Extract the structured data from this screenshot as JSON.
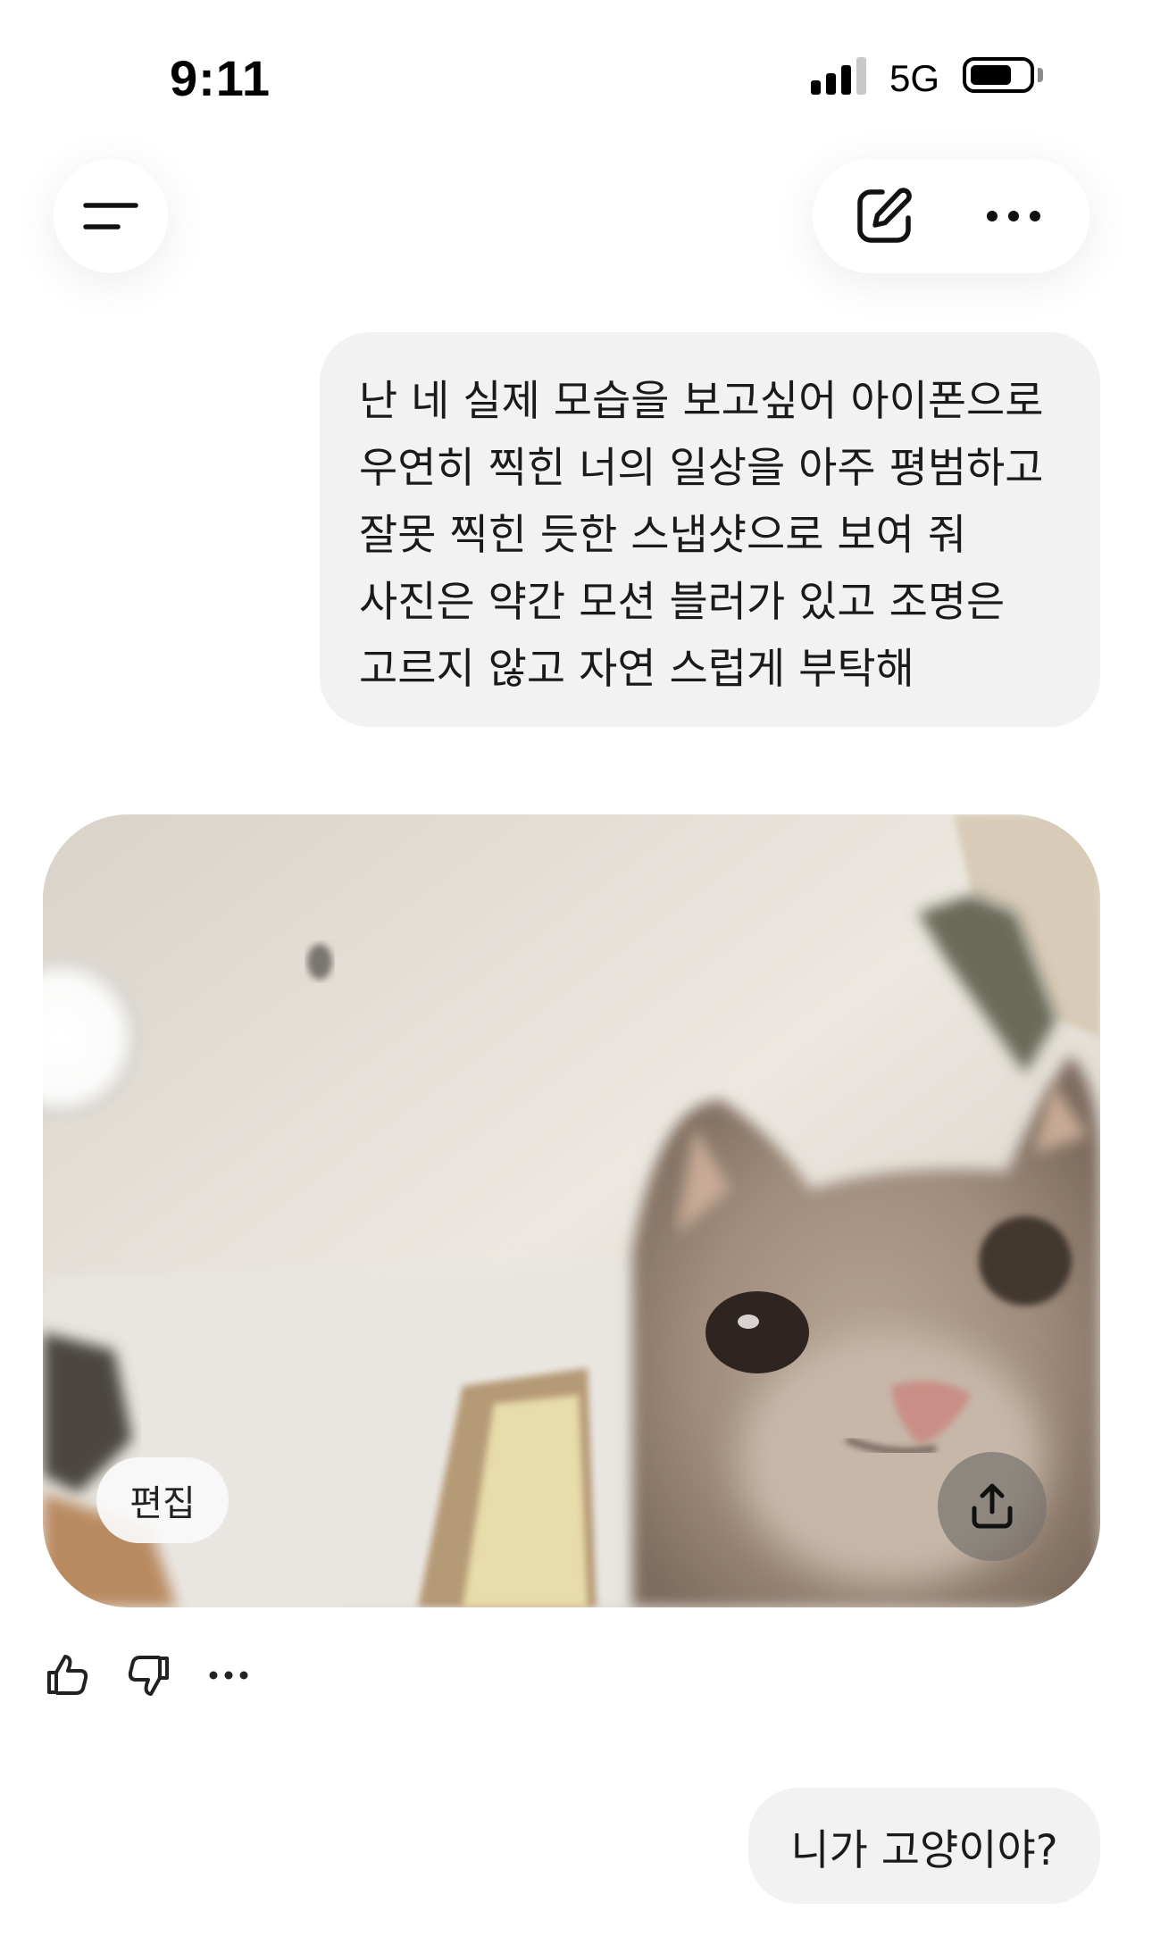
{
  "status_bar": {
    "time": "9:11",
    "network": "5G",
    "signal_bars_filled": 3,
    "signal_bars_total": 4,
    "battery_level": 0.72
  },
  "header": {
    "menu_icon": "menu-icon",
    "new_chat_icon": "compose-icon",
    "more_icon": "more-horizontal-icon"
  },
  "messages": [
    {
      "role": "user",
      "lines": [
        "난 네 실제 모습을 보고싶어 아이폰으로",
        "우연히 찍힌 너의 일상을 아주 평범하고",
        "잘못 찍힌 듯한 스냅샷으로 보여 줘",
        "사진은 약간 모션 블러가 있고 조명은",
        "고르지 않고 자연 스럽게 부탁해"
      ]
    },
    {
      "role": "assistant",
      "image": {
        "edit_label": "편집",
        "share_icon": "share-upload-icon"
      },
      "feedback": {
        "like_icon": "thumbs-up-icon",
        "dislike_icon": "thumbs-down-icon",
        "more_icon": "more-horizontal-icon"
      }
    },
    {
      "role": "user",
      "text": "니가 고양이야?"
    }
  ],
  "colors": {
    "bubble": "#f2f2f2",
    "background": "#ffffff",
    "text": "#1a1a1a"
  }
}
